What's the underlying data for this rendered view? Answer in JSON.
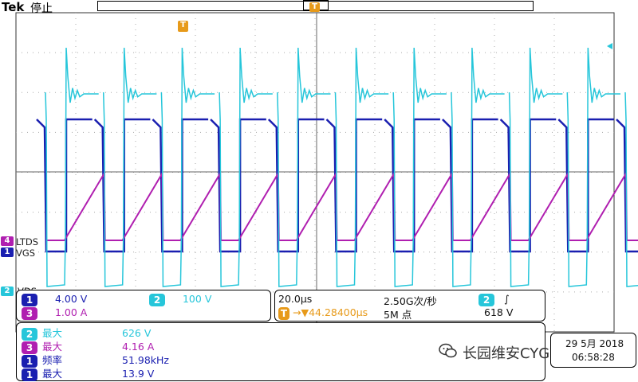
{
  "header": {
    "brand": "Tek",
    "state": "停止"
  },
  "markers": {
    "trigger": "T"
  },
  "channel_labels": {
    "ch4": "LTDS",
    "ch1": "VGS",
    "ch2": "VDS"
  },
  "settings": {
    "ch1_num": "1",
    "ch1_scale": "4.00 V",
    "ch2_num": "2",
    "ch2_scale": "100 V",
    "ch3_num": "3",
    "ch3_scale": "1.00 A",
    "timebase": "20.0µs",
    "sample_rate": "2.50G次/秒",
    "trigger_pos": "→▼44.28400µs",
    "record_length": "5M 点",
    "trig_ch": "2",
    "trig_slope": "∫",
    "trig_level": "618 V"
  },
  "measurements": [
    {
      "ch": "2",
      "name": "最大",
      "value": "626 V",
      "color": "#26c6da"
    },
    {
      "ch": "3",
      "name": "最大",
      "value": "4.16 A",
      "color": "#b01fb0"
    },
    {
      "ch": "1",
      "name": "频率",
      "value": "51.98kHz",
      "color": "#1a1fb0"
    },
    {
      "ch": "1",
      "name": "最大",
      "value": "13.9 V",
      "color": "#1a1fb0"
    }
  ],
  "datetime": {
    "date": "29 5月 2018",
    "time": "06:58:28"
  },
  "watermark": "长园维安CYGWAYON",
  "colors": {
    "ch1": "#1a1fb0",
    "ch2": "#26c6da",
    "ch3": "#b01fb0",
    "ch4": "#b01fb0",
    "trigger": "#e79a1a"
  }
}
